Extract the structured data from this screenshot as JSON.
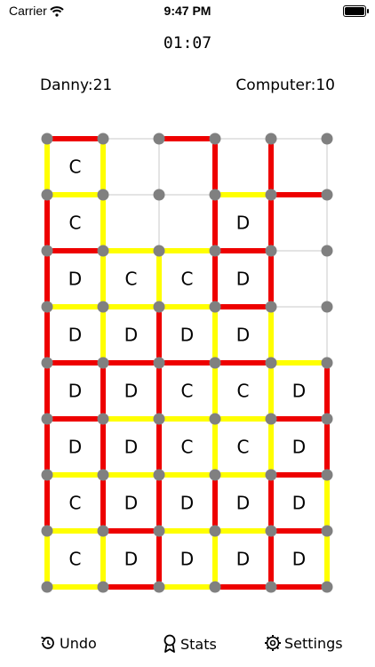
{
  "status_bar": {
    "carrier": "Carrier",
    "time": "9:47 PM"
  },
  "timer": "01:07",
  "scores": {
    "player": "Danny:21",
    "computer": "Computer:10"
  },
  "colors": {
    "red": "#ee0000",
    "yellow": "#ffff00",
    "dot": "#808080",
    "grid": "#c8c8c8"
  },
  "board": {
    "cols": 5,
    "rows": 8,
    "cells": [
      [
        "C",
        "",
        "",
        "",
        ""
      ],
      [
        "C",
        "",
        "",
        "D",
        ""
      ],
      [
        "D",
        "C",
        "C",
        "D",
        ""
      ],
      [
        "D",
        "D",
        "D",
        "D",
        ""
      ],
      [
        "D",
        "D",
        "C",
        "C",
        "D"
      ],
      [
        "D",
        "D",
        "C",
        "C",
        "D"
      ],
      [
        "C",
        "D",
        "D",
        "D",
        "D"
      ],
      [
        "C",
        "D",
        "D",
        "D",
        "D"
      ]
    ],
    "h_lines": [
      [
        "r",
        "",
        "r",
        "",
        ""
      ],
      [
        "y",
        "",
        "",
        "y",
        "r"
      ],
      [
        "r",
        "y",
        "y",
        "r",
        ""
      ],
      [
        "y",
        "y",
        "y",
        "r",
        ""
      ],
      [
        "r",
        "r",
        "r",
        "r",
        "y"
      ],
      [
        "r",
        "y",
        "y",
        "y",
        "r"
      ],
      [
        "y",
        "y",
        "y",
        "y",
        "r"
      ],
      [
        "y",
        "r",
        "y",
        "y",
        "r"
      ],
      [
        "y",
        "r",
        "y",
        "r",
        "r"
      ]
    ],
    "v_lines": [
      [
        "y",
        "y",
        "",
        "r",
        "r",
        ""
      ],
      [
        "r",
        "y",
        "",
        "r",
        "r",
        ""
      ],
      [
        "r",
        "y",
        "y",
        "r",
        "r",
        ""
      ],
      [
        "r",
        "y",
        "r",
        "y",
        "y",
        ""
      ],
      [
        "r",
        "r",
        "r",
        "y",
        "y",
        "r"
      ],
      [
        "r",
        "r",
        "r",
        "y",
        "y",
        "r"
      ],
      [
        "r",
        "r",
        "r",
        "r",
        "r",
        "y"
      ],
      [
        "y",
        "y",
        "r",
        "y",
        "r",
        "y"
      ]
    ]
  },
  "toolbar": {
    "undo": "Undo",
    "stats": "Stats",
    "settings": "Settings"
  },
  "icons": {
    "undo": "undo-icon",
    "stats": "ribbon-icon",
    "settings": "gear-icon",
    "wifi": "wifi-icon",
    "battery": "battery-icon"
  }
}
